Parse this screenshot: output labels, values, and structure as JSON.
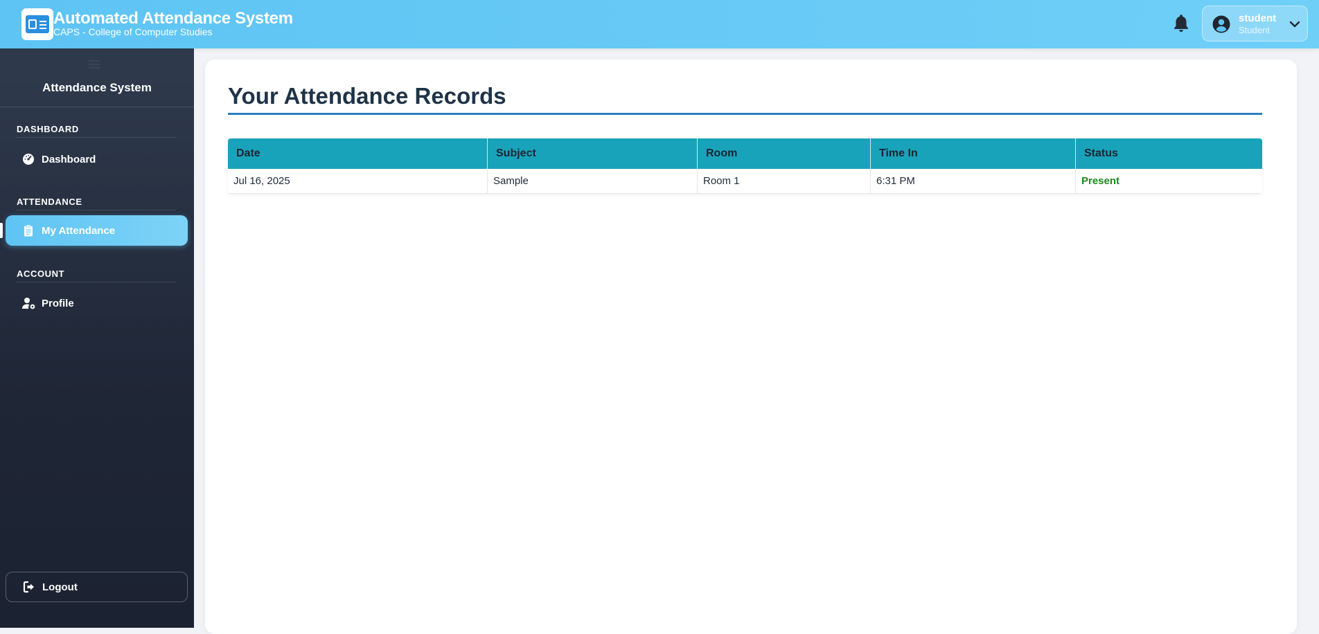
{
  "header": {
    "title": "Automated Attendance System",
    "subtitle": "CAPS - College of Computer Studies",
    "user_name": "student",
    "user_role": "Student",
    "icons": {
      "logo": "id-card-icon",
      "notifications": "bell-icon",
      "avatar": "user-circle-icon",
      "menu": "chevron-down-icon"
    },
    "accent_color": "#5ec4f4"
  },
  "sidebar": {
    "toggle_icon": "menu-toggle-icon",
    "title": "Attendance System",
    "sections": [
      {
        "label": "DASHBOARD",
        "items": [
          {
            "label": "Dashboard",
            "icon": "gauge-icon",
            "active": false
          }
        ]
      },
      {
        "label": "ATTENDANCE",
        "items": [
          {
            "label": "My Attendance",
            "icon": "clipboard-list-icon",
            "active": true
          }
        ]
      },
      {
        "label": "ACCOUNT",
        "items": [
          {
            "label": "Profile",
            "icon": "user-gear-icon",
            "active": false
          }
        ]
      }
    ],
    "logout": {
      "label": "Logout",
      "icon": "sign-out-icon"
    }
  },
  "main": {
    "title": "Your Attendance Records",
    "table": {
      "columns": [
        "Date",
        "Subject",
        "Room",
        "Time In",
        "Status"
      ],
      "rows": [
        {
          "date": "Jul 16, 2025",
          "subject": "Sample",
          "room": "Room 1",
          "time_in": "6:31 PM",
          "status": "Present"
        }
      ],
      "header_color": "#19a3ba",
      "status_present_color": "#1a8a1a"
    }
  }
}
